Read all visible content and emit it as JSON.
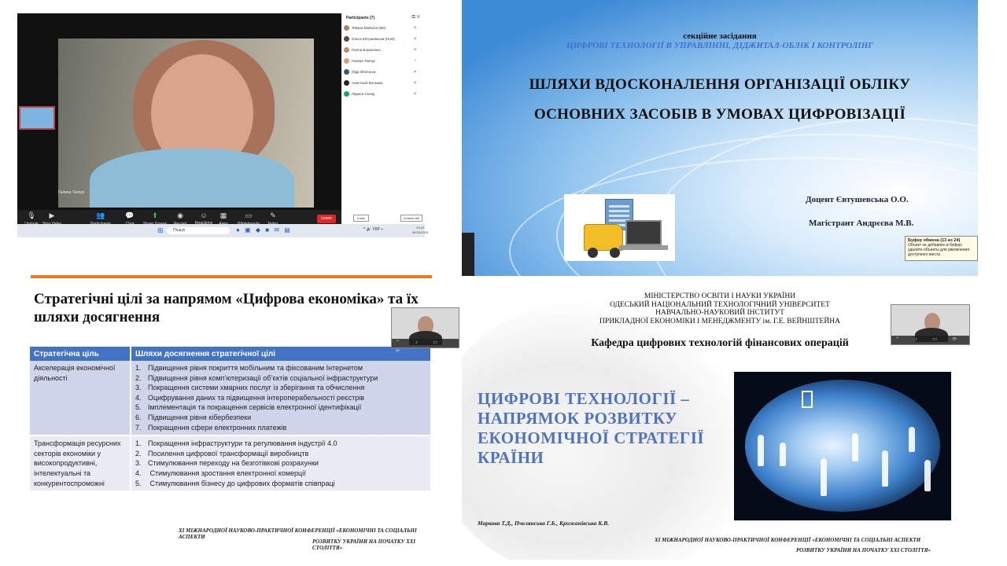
{
  "zoom": {
    "speaker_name": "Галина Ткачук",
    "toolbar": [
      {
        "icon": "mic-icon",
        "label": "Unmute"
      },
      {
        "icon": "video-icon",
        "label": "Stop Video"
      },
      {
        "icon": "participants-icon",
        "label": "Participants"
      },
      {
        "icon": "chat-icon",
        "label": "Chat"
      },
      {
        "icon": "share-screen-icon",
        "label": "Share Screen"
      },
      {
        "icon": "record-icon",
        "label": "Record"
      },
      {
        "icon": "reactions-icon",
        "label": "Reactions"
      },
      {
        "icon": "apps-icon",
        "label": "Apps"
      },
      {
        "icon": "whiteboards-icon",
        "label": "Whiteboards"
      },
      {
        "icon": "notes-icon",
        "label": "Notes"
      }
    ],
    "leave_label": "Leave",
    "participants_title": "Participants (7)",
    "participants": [
      {
        "name": "Tetiana Markova (Me)",
        "color": "#b08060"
      },
      {
        "name": "Ольга Євтушевська (Host)",
        "color": "#5a4a3a"
      },
      {
        "name": "Галіна Борисенко",
        "color": "#c08a70"
      },
      {
        "name": "Галина Ткачук",
        "color": "#d4a080"
      },
      {
        "name": "Olga Ohrimova",
        "color": "#3a5a6a"
      },
      {
        "name": "Анастасія Волкова",
        "color": "#222222"
      },
      {
        "name": "Лариса Скляр",
        "color": "#1aa07a"
      }
    ],
    "invite_label": "Invite",
    "unmute_me_label": "Unmute Me",
    "taskbar": {
      "search_placeholder": "Пошук",
      "lang": "УКР",
      "time": "13:22",
      "date": "28.03.2023"
    }
  },
  "slide2": {
    "kicker": "секційне засідання",
    "subtitle": "ЦИФРОВІ ТЕХНОЛОГІЇ В УПРАВЛІННІ, ДІДЖИТАЛ-ОБЛІК І КОНТРОЛІНГ",
    "title_line1": "ШЛЯХИ ВДОСКОНАЛЕННЯ ОРГАНІЗАЦІЇ ОБЛІКУ",
    "title_line2": "ОСНОВНИХ ЗАСОБІВ В УМОВАХ ЦИФРОВІЗАЦІЇ",
    "author1": "Доцент Євтушевська О.О.",
    "author2": "Магістрант Андрєєва М.В.",
    "tooltip_title": "Буфер обмена (13 из 24)",
    "tooltip_text": "Объект не добавлен в буфер; удалите объекты для увеличения доступного места"
  },
  "slide3": {
    "title": "Стратегічні цілі за напрямом «Цифрова економіка» та їх шляхи досягнення",
    "headers": [
      "Стратегічна ціль",
      "Шляхи досягнення стратегічної цілі"
    ],
    "rows": [
      {
        "goal": "Акселерація економічної діяльності",
        "items": [
          "Підвищення рівня покриття мобільним та фіксованим Інтернетом",
          "Підвищення рівня комп’ютеризації об’єктів соціальної інфраструктури",
          "Покращення системи хмарних послуг із зберігання та обчислення",
          "Оцифрування даних та підвищення інтероперабельності реєстрів",
          "Імплементація та покращення сервісів електронної ідентифікації",
          "Підвищення рівня кібербезпеки",
          "Покращення сфери електронних платежів"
        ]
      },
      {
        "goal": "Трансформація ресурсних секторів економіки у високопродуктивні, інтелектуальні та конкурентоспроможні",
        "items": [
          "Покращення інфраструктури та регулювання індустрії 4.0",
          "Посилення цифрової трансформації виробництв",
          "Стимулювання переходу на безготівкові розрахунки",
          " Стимулювання зростання електронної комерції",
          " Стимулювання бізнесу до цифрових форматів співпраці"
        ]
      }
    ],
    "footer_line1": "XI МІЖНАРОДНОЇ НАУКОВО-ПРАКТИЧНОЇ КОНФЕРЕНЦІЇ «ЕКОНОМІЧНІ ТА СОЦІАЛЬНІ АСПЕКТИ",
    "footer_line2": "РОЗВИТКУ УКРАЇНИ НА ПОЧАТКУ ХХІ СТОЛІТТЯ»"
  },
  "slide4": {
    "ministry_lines": [
      "МІНІСТЕРСТВО ОСВІТИ І НАУКИ УКРАЇНИ",
      "ОДЕСЬКИЙ НАЦІОНАЛЬНИЙ ТЕХНОЛОГІЧНИЙ УНІВЕРСИТЕТ",
      "НАВЧАЛЬНО-НАУКОВИЙ ІНСТИТУТ",
      "ПРИКЛАДНОЇ ЕКОНОМІКИ І МЕНЕДЖМЕНТУ ім. Г.Е. ВЕЙНШТЕЙНА"
    ],
    "department": "Кафедра цифрових технологій фінансових операцій",
    "title": "ЦИФРОВІ ТЕХНОЛОГІЇ – НАПРЯМОК РОЗВИТКУ ЕКОНОМІЧНОЇ СТРАТЕГІЇ КРАЇНИ",
    "authors": "Маркова Т.Д., Пчелянська Г.Б., Крижанівська К.В.",
    "footer_line1": "XI МІЖНАРОДНОЇ НАУКОВО-ПРАКТИЧНОЇ КОНФЕРЕНЦІЇ «ЕКОНОМІЧНІ ТА СОЦІАЛЬНІ АСПЕКТИ",
    "footer_line2": "РОЗВИТКУ УКРАЇНИ НА ПОЧАТКУ ХХІ СТОЛІТТЯ»"
  }
}
